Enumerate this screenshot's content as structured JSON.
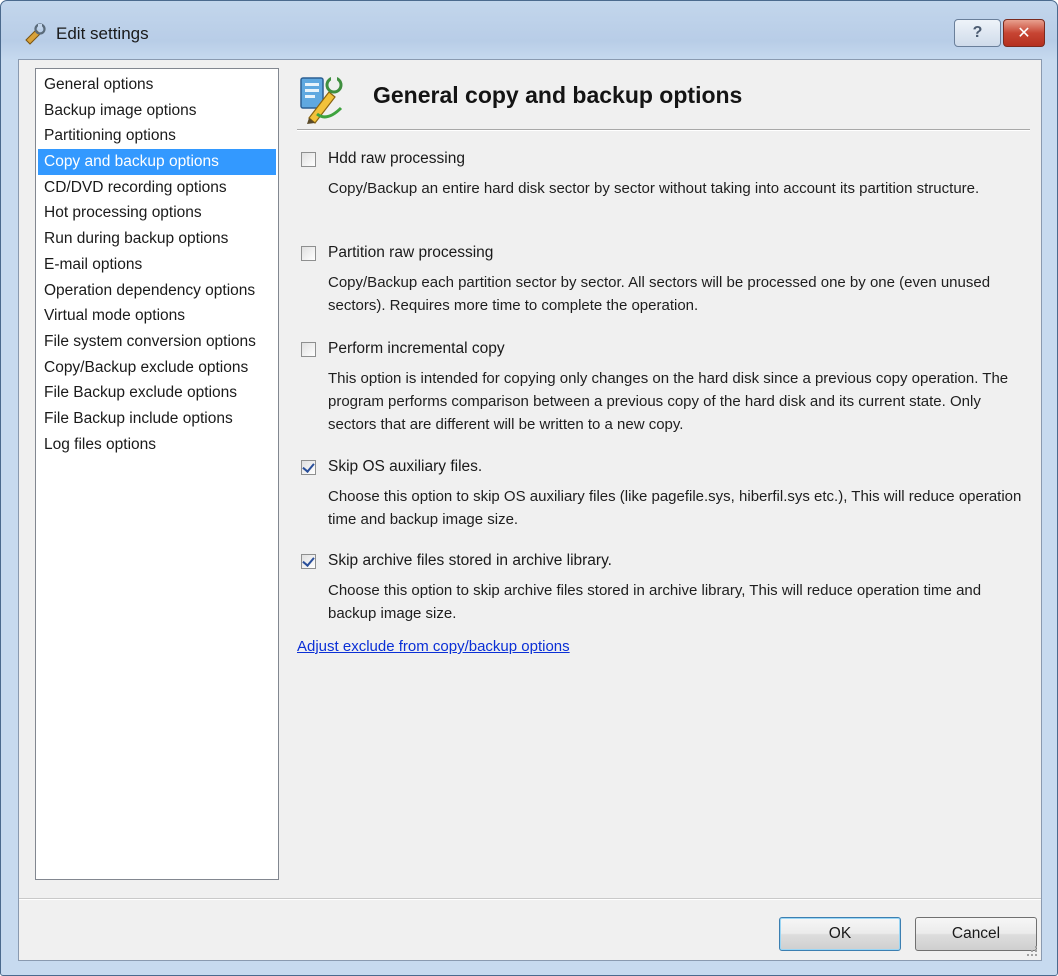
{
  "window": {
    "title": "Edit settings",
    "help_label": "?",
    "close_label": "✕"
  },
  "sidebar": {
    "items": [
      {
        "label": "General options",
        "selected": false
      },
      {
        "label": "Backup image options",
        "selected": false
      },
      {
        "label": "Partitioning options",
        "selected": false
      },
      {
        "label": "Copy and backup options",
        "selected": true
      },
      {
        "label": "CD/DVD recording options",
        "selected": false
      },
      {
        "label": "Hot processing options",
        "selected": false
      },
      {
        "label": "Run during backup options",
        "selected": false
      },
      {
        "label": "E-mail options",
        "selected": false
      },
      {
        "label": "Operation dependency options",
        "selected": false
      },
      {
        "label": "Virtual mode options",
        "selected": false
      },
      {
        "label": "File system conversion options",
        "selected": false
      },
      {
        "label": "Copy/Backup exclude options",
        "selected": false
      },
      {
        "label": "File Backup exclude options",
        "selected": false
      },
      {
        "label": "File Backup include options",
        "selected": false
      },
      {
        "label": "Log files options",
        "selected": false
      }
    ]
  },
  "main": {
    "title": "General copy and backup options",
    "options": [
      {
        "label": "Hdd raw processing",
        "checked": false,
        "description": "Copy/Backup an entire hard disk sector by sector without taking into account its partition structure."
      },
      {
        "label": "Partition raw processing",
        "checked": false,
        "description": "Copy/Backup each partition sector by sector. All sectors will be processed one by one (even unused sectors). Requires more time to complete the operation."
      },
      {
        "label": "Perform incremental copy",
        "checked": false,
        "description": "This option is intended for copying only changes on the hard disk since a previous copy operation. The program performs comparison between a previous copy of the hard disk and its current state. Only sectors that are different will be written to a new copy."
      },
      {
        "label": "Skip OS auxiliary files.",
        "checked": true,
        "description": "Choose this option to skip OS auxiliary files (like pagefile.sys, hiberfil.sys etc.), This will reduce operation time and backup image size."
      },
      {
        "label": "Skip archive files stored in archive library.",
        "checked": true,
        "description": "Choose this option to skip archive files stored in archive library, This will reduce operation time and backup image size."
      }
    ],
    "link_label": "Adjust exclude from copy/backup options"
  },
  "footer": {
    "ok_label": "OK",
    "cancel_label": "Cancel"
  },
  "colors": {
    "selection": "#3399ff",
    "link": "#0a2fd6",
    "close_button": "#c74533"
  }
}
